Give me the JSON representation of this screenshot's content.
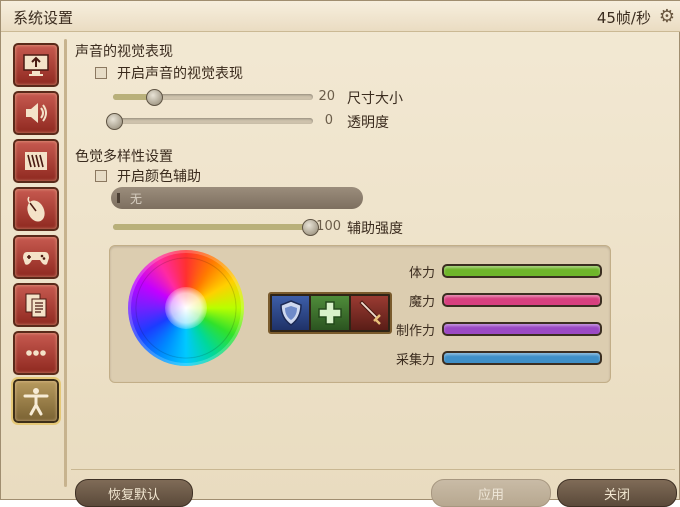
{
  "window": {
    "title": "系统设置",
    "fps": "45帧/秒"
  },
  "sidebar": {
    "items": [
      {
        "name": "display",
        "icon": "monitor-icon"
      },
      {
        "name": "sound",
        "icon": "speaker-icon"
      },
      {
        "name": "theme",
        "icon": "panel-icon"
      },
      {
        "name": "mouse",
        "icon": "mouse-icon"
      },
      {
        "name": "gamepad",
        "icon": "gamepad-icon"
      },
      {
        "name": "documents",
        "icon": "document-icon"
      },
      {
        "name": "other",
        "icon": "more-icon"
      },
      {
        "name": "accessibility",
        "icon": "accessibility-icon",
        "active": true
      }
    ]
  },
  "visual_sound": {
    "heading": "声音的视觉表现",
    "enable_label": "开启声音的视觉表现",
    "enable_checked": false,
    "size": {
      "label": "尺寸大小",
      "value": "20",
      "fraction": 0.2
    },
    "opacity": {
      "label": "透明度",
      "value": "0",
      "fraction": 0.0
    }
  },
  "color_diversity": {
    "heading": "色觉多样性设置",
    "enable_label": "开启颜色辅助",
    "enable_checked": false,
    "filter_value": "无",
    "strength": {
      "label": "辅助强度",
      "value": "100",
      "fraction": 1.0
    }
  },
  "preview": {
    "bars": [
      {
        "label": "体力",
        "color": "#6fb52a"
      },
      {
        "label": "魔力",
        "color": "#d8407f"
      },
      {
        "label": "制作力",
        "color": "#9b49c4"
      },
      {
        "label": "采集力",
        "color": "#3f8fc7"
      }
    ],
    "role_icons": [
      "shield-icon",
      "healer-cross-icon",
      "sword-icon"
    ]
  },
  "footer": {
    "restore_label": "恢复默认",
    "apply_label": "应用",
    "close_label": "关闭"
  }
}
